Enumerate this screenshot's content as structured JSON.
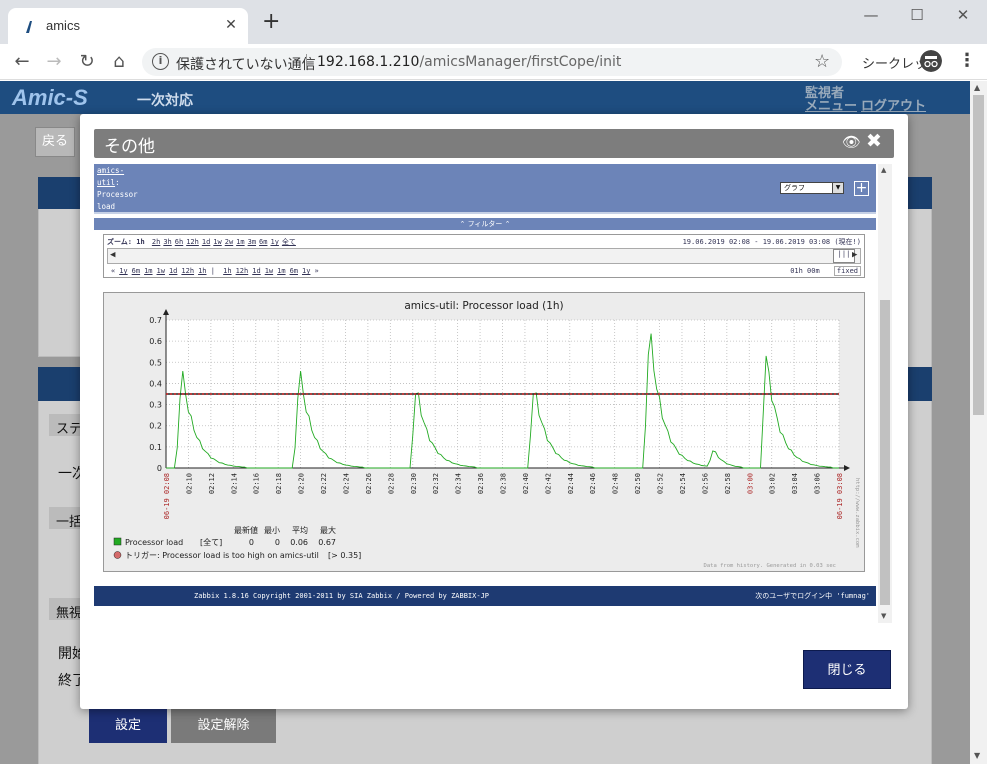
{
  "browser": {
    "tab_title": "amics",
    "security_text": "保護されていない通信",
    "url_host": "192.168.1.210",
    "url_path": "/amicsManager/firstCope/init",
    "incognito_label": "シークレット"
  },
  "app": {
    "logo": "Amic-S",
    "title": "一次対応",
    "user_role": "監視者",
    "menu_link": "メニュー",
    "logout_link": "ログアウト",
    "back_button": "戻る",
    "bg_label_status": "ステ",
    "bg_label_first": "一次",
    "bg_label_first2": "一括",
    "bg_label_none": "無視",
    "bg_label_start": "開始",
    "bg_label_end": "終了",
    "set_button": "設定",
    "unset_button": "設定解除"
  },
  "modal": {
    "title": "その他",
    "close_button": "閉じる"
  },
  "zabbix": {
    "breadcrumb_host": "amics-",
    "breadcrumb_host2": "util",
    "breadcrumb_item1": "Processor",
    "breadcrumb_item2": "load",
    "select_value": "グラフ",
    "filter_label": "フィルター",
    "zoom_label": "ズーム:",
    "zoom_current": "1h",
    "zoom_options": [
      "2h",
      "3h",
      "6h",
      "12h",
      "1d",
      "1w",
      "2w",
      "1m",
      "3m",
      "6m",
      "1y",
      "全て"
    ],
    "period_from": "19.06.2019 02:08",
    "period_to": "19.06.2019 03:08",
    "period_now": "(現在!)",
    "nav_back": [
      "«",
      "1y",
      "6m",
      "1m",
      "1w",
      "1d",
      "12h",
      "1h"
    ],
    "nav_fwd": [
      "1h",
      "12h",
      "1d",
      "1w",
      "1m",
      "6m",
      "1y",
      "»"
    ],
    "length": "01h 00m",
    "fixed": "fixed",
    "footer_left": "Zabbix 1.8.16 Copyright 2001-2011 by SIA Zabbix  /  Powered by ZABBIX-JP",
    "footer_right": "次のユーザでログイン中 'fumnag'"
  },
  "chart_data": {
    "type": "line",
    "title": "amics-util: Processor load (1h)",
    "ylim": [
      0,
      0.7
    ],
    "yticks": [
      0,
      0.1,
      0.2,
      0.3,
      0.4,
      0.5,
      0.6,
      0.7
    ],
    "xlim": [
      8,
      68
    ],
    "x_tick_labels": [
      "02:08",
      "02:10",
      "02:12",
      "02:14",
      "02:16",
      "02:18",
      "02:20",
      "02:22",
      "02:24",
      "02:26",
      "02:28",
      "02:30",
      "02:32",
      "02:34",
      "02:36",
      "02:38",
      "02:40",
      "02:42",
      "02:44",
      "02:46",
      "02:48",
      "02:50",
      "02:52",
      "02:54",
      "02:56",
      "02:58",
      "03:00",
      "03:02",
      "03:04",
      "03:06",
      "03:08"
    ],
    "x_tick_highlight": [
      "02:08",
      "03:00",
      "03:08"
    ],
    "x_tick_date_prefix": "06-19",
    "peaks": [
      {
        "x": 9.4,
        "y": 0.47
      },
      {
        "x": 19.9,
        "y": 0.47
      },
      {
        "x": 30.3,
        "y": 0.39
      },
      {
        "x": 40.8,
        "y": 0.39
      },
      {
        "x": 51.1,
        "y": 0.67
      },
      {
        "x": 56.8,
        "y": 0.09
      },
      {
        "x": 61.5,
        "y": 0.53
      }
    ],
    "trigger_value": 0.35,
    "series": [
      {
        "name": "Processor load",
        "color": "#22aa22",
        "scope": "[全て]",
        "last": "0",
        "min": "0",
        "avg": "0.06",
        "max": "0.67"
      }
    ],
    "legend_headers": [
      "最新値",
      "最小",
      "平均",
      "最大"
    ],
    "trigger_label": "トリガー: Processor load is too high on amics-util",
    "trigger_cond": "[> 0.35]",
    "trigger_color": "#cc2222",
    "side_text": "http://www.zabbix.com",
    "note": "Data from history. Generated in 0.03 sec"
  }
}
